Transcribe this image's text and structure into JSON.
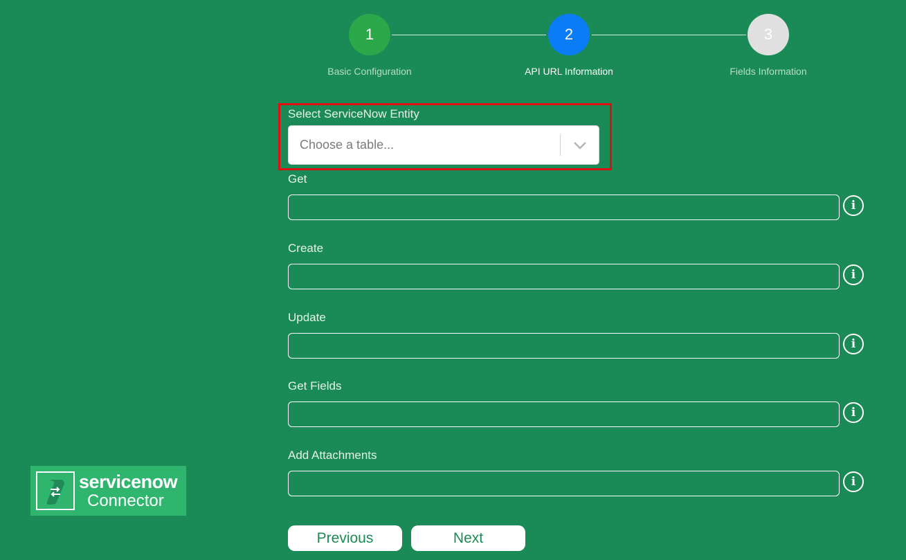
{
  "stepper": {
    "steps": [
      {
        "number": "1",
        "label": "Basic Configuration",
        "state": "complete",
        "color": "#2ba84a"
      },
      {
        "number": "2",
        "label": "API URL Information",
        "state": "active",
        "color": "#0a7cf5"
      },
      {
        "number": "3",
        "label": "Fields Information",
        "state": "pending",
        "color": "#e0e0e0"
      }
    ]
  },
  "entity": {
    "label": "Select ServiceNow Entity",
    "placeholder": "Choose a table..."
  },
  "fields": {
    "get": {
      "label": "Get",
      "value": ""
    },
    "create": {
      "label": "Create",
      "value": ""
    },
    "update": {
      "label": "Update",
      "value": ""
    },
    "get_fields": {
      "label": "Get Fields",
      "value": ""
    },
    "add_attachments": {
      "label": "Add Attachments",
      "value": ""
    }
  },
  "buttons": {
    "previous": "Previous",
    "next": "Next"
  },
  "logo": {
    "brand": "servicenow",
    "sub": "Connector"
  },
  "colors": {
    "background": "#1a8a56",
    "highlight": "#e11010",
    "logo_bg": "#2fb56e"
  }
}
